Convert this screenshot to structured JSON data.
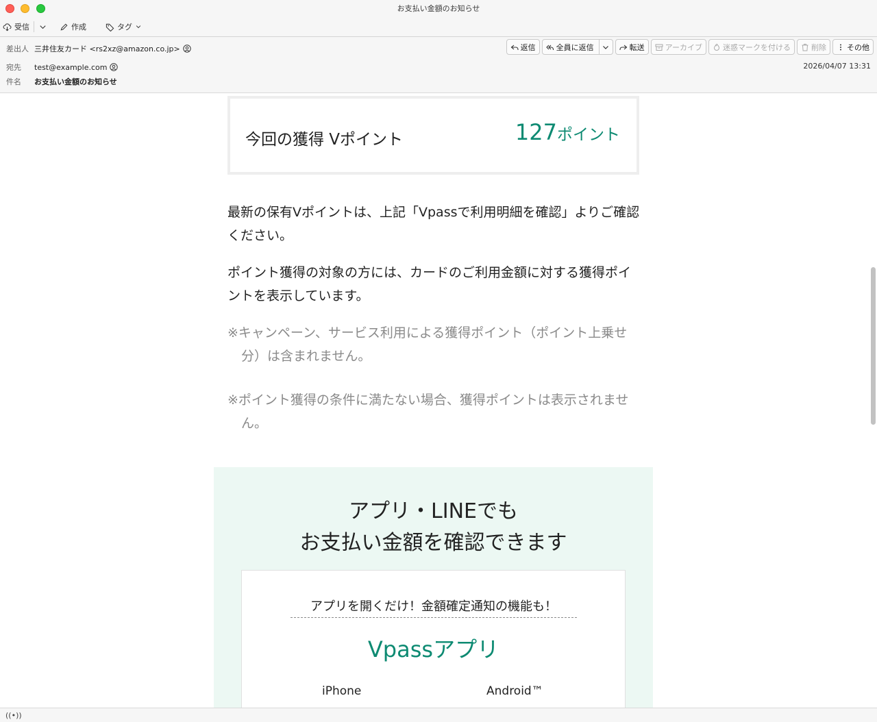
{
  "window": {
    "title": "お支払い金額のお知らせ"
  },
  "toolbar": {
    "receive": "受信",
    "compose": "作成",
    "tag": "タグ"
  },
  "header": {
    "from_label": "差出人",
    "from_value": "三井住友カード <rs2xz@amazon.co.jp>",
    "to_label": "宛先",
    "to_value": "test@example.com",
    "subject_label": "件名",
    "subject_value": "お支払い金額のお知らせ",
    "date": "2026/04/07 13:31"
  },
  "actions": {
    "reply": "返信",
    "reply_all": "全員に返信",
    "forward": "転送",
    "archive": "アーカイブ",
    "junk": "迷惑マークを付ける",
    "delete": "削除",
    "more": "その他"
  },
  "body": {
    "points_label": "今回の獲得 Vポイント",
    "points_value": "127",
    "points_unit": "ポイント",
    "para1": "最新の保有Vポイントは、上記「Vpassで利用明細を確認」よりご確認ください。",
    "para2": "ポイント獲得の対象の方には、カードのご利用金額に対する獲得ポイントを表示しています。",
    "note1": "※キャンペーン、サービス利用による獲得ポイント（ポイント上乗せ分）は含まれません。",
    "note2": "※ポイント獲得の条件に満たない場合、獲得ポイントは表示されません。",
    "promo_title_line1": "アプリ・LINEでも",
    "promo_title_line2": "お支払い金額を確認できます",
    "app_lead": "アプリを開くだけ！金額確定通知の機能も！",
    "app_name": "Vpassアプリ",
    "store_iphone": "iPhone",
    "store_android": "Android™"
  },
  "colors": {
    "accent": "#0d8a72",
    "promo_bg": "#ecf8f3"
  }
}
